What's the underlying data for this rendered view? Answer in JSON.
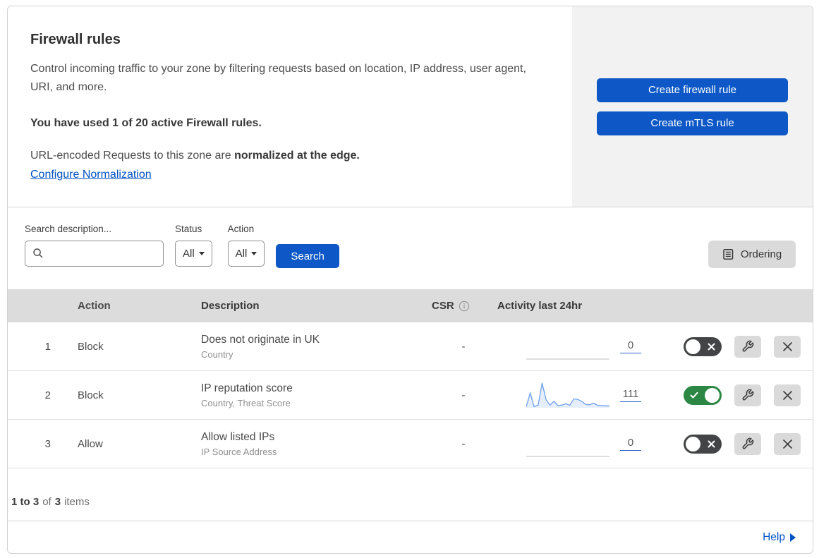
{
  "header": {
    "title": "Firewall rules",
    "description": "Control incoming traffic to your zone by filtering requests based on location, IP address, user agent, URI, and more.",
    "usage": "You have used 1 of 20 active Firewall rules.",
    "normalization_prefix": "URL-encoded Requests to this zone are ",
    "normalization_bold": "normalized at the edge.",
    "normalization_link": "Configure Normalization",
    "buttons": {
      "create_firewall": "Create firewall rule",
      "create_mtls": "Create mTLS rule"
    }
  },
  "filters": {
    "search_label": "Search description...",
    "search_value": "",
    "status_label": "Status",
    "status_value": "All",
    "action_label": "Action",
    "action_value": "All",
    "search_button": "Search",
    "ordering_button": "Ordering"
  },
  "table": {
    "columns": {
      "action": "Action",
      "description": "Description",
      "csr": "CSR",
      "activity": "Activity last 24hr"
    },
    "rows": [
      {
        "number": "1",
        "action": "Block",
        "description": "Does not originate in UK",
        "criteria": "Country",
        "csr": "-",
        "count": "0",
        "enabled": false
      },
      {
        "number": "2",
        "action": "Block",
        "description": "IP reputation score",
        "criteria": "Country, Threat Score",
        "csr": "-",
        "count": "111",
        "enabled": true
      },
      {
        "number": "3",
        "action": "Allow",
        "description": "Allow listed IPs",
        "criteria": "IP Source Address",
        "csr": "-",
        "count": "0",
        "enabled": false
      }
    ]
  },
  "footer": {
    "range": "1 to 3",
    "of": "of",
    "total": "3",
    "items": "items",
    "help": "Help"
  },
  "chart_data": [
    {
      "type": "area",
      "name": "rule-1-activity-sparkline",
      "title": "Activity last 24hr — rule 1 (Does not originate in UK)",
      "values": [
        0,
        0,
        0,
        0,
        0,
        0,
        0,
        0,
        0,
        0,
        0,
        0,
        0,
        0,
        0,
        0,
        0,
        0,
        0,
        0,
        0,
        0
      ],
      "total": 0,
      "line_color": "#c9c9c9",
      "fill_color": "transparent"
    },
    {
      "type": "area",
      "name": "rule-2-activity-sparkline",
      "title": "Activity last 24hr — rule 2 (IP reputation score)",
      "values": [
        4,
        55,
        4,
        10,
        92,
        30,
        10,
        24,
        8,
        10,
        15,
        9,
        33,
        31,
        24,
        13,
        11,
        17,
        9,
        8,
        7,
        7
      ],
      "total": 111,
      "line_color": "#6d9ff0",
      "fill_color": "rgba(109,159,240,0.18)"
    },
    {
      "type": "area",
      "name": "rule-3-activity-sparkline",
      "title": "Activity last 24hr — rule 3 (Allow listed IPs)",
      "values": [
        0,
        0,
        0,
        0,
        0,
        0,
        0,
        0,
        0,
        0,
        0,
        0,
        0,
        0,
        0,
        0,
        0,
        0,
        0,
        0,
        0,
        0
      ],
      "total": 0,
      "line_color": "#c9c9c9",
      "fill_color": "transparent"
    }
  ],
  "colors": {
    "accent_blue": "#0d58c6",
    "link_blue": "#0051c3",
    "toggle_on_green": "#2b8743",
    "toggle_off_gray": "#424445",
    "table_header_gray": "#dcdcdc",
    "panel_gray": "#f2f2f2",
    "control_gray": "#dadada",
    "sparkline_blue": "#6d9ff0"
  }
}
